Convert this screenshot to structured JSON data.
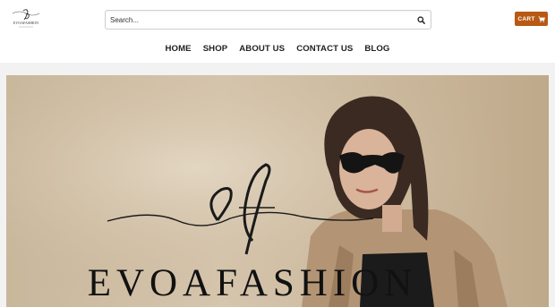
{
  "header": {
    "logo_text": "EVOAFASHION",
    "search": {
      "placeholder": "Search..."
    },
    "cart_label": "CART"
  },
  "nav": {
    "items": [
      {
        "label": "HOME"
      },
      {
        "label": "SHOP"
      },
      {
        "label": "ABOUT US"
      },
      {
        "label": "CONTACT US"
      },
      {
        "label": "BLOG"
      }
    ]
  },
  "hero": {
    "monogram": "ef",
    "brand": "EVOAFASHION"
  },
  "colors": {
    "accent": "#b85a13",
    "nav_text": "#222222",
    "band": "#f2f2f2"
  }
}
